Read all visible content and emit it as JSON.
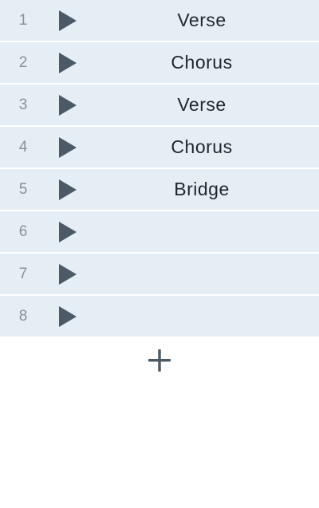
{
  "sections": [
    {
      "index": "1",
      "name": "Verse",
      "icon": "play-icon"
    },
    {
      "index": "2",
      "name": "Chorus",
      "icon": "play-icon"
    },
    {
      "index": "3",
      "name": "Verse",
      "icon": "play-icon"
    },
    {
      "index": "4",
      "name": "Chorus",
      "icon": "play-icon"
    },
    {
      "index": "5",
      "name": "Bridge",
      "icon": "play-icon"
    },
    {
      "index": "6",
      "name": "",
      "icon": "play-icon"
    },
    {
      "index": "7",
      "name": "",
      "icon": "play-icon"
    },
    {
      "index": "8",
      "name": "",
      "icon": "play-icon"
    }
  ],
  "add_button": {
    "icon": "plus-icon"
  },
  "colors": {
    "row_background": "#e6eef5",
    "row_separator": "#ffffff",
    "play_icon": "#4b5a66",
    "number_text": "#8a9096",
    "label_text": "#1f262c",
    "add_icon": "#4b5a66"
  }
}
